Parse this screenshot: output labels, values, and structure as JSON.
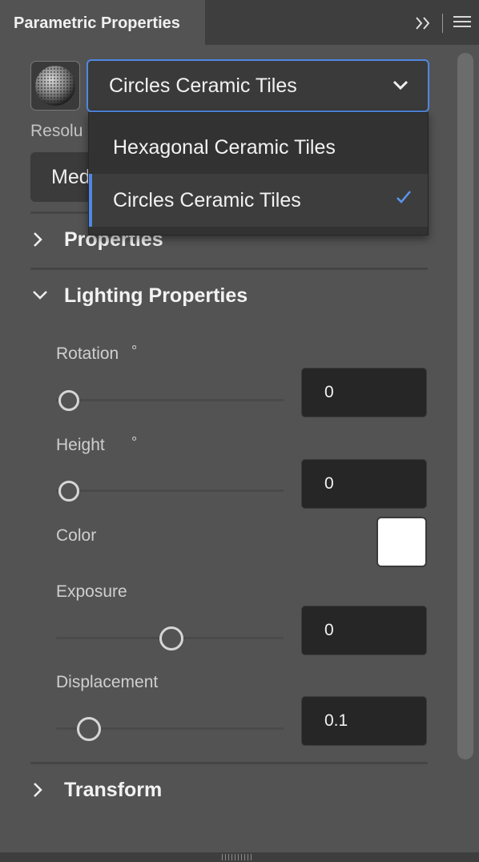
{
  "panel": {
    "title": "Parametric Properties"
  },
  "material": {
    "selected": "Circles Ceramic Tiles",
    "options": [
      "Hexagonal Ceramic Tiles",
      "Circles Ceramic Tiles"
    ]
  },
  "resolution": {
    "label": "Resolu",
    "value": "Med"
  },
  "sections": {
    "properties": "Properties",
    "lighting": "Lighting Properties",
    "transform": "Transform"
  },
  "lighting": {
    "rotation": {
      "label": "Rotation",
      "unit": "°",
      "value": "0",
      "slider_fraction": 0.0
    },
    "height": {
      "label": "Height",
      "unit": "°",
      "value": "0",
      "slider_fraction": 0.0
    },
    "color": {
      "label": "Color",
      "value": "#ffffff"
    },
    "exposure": {
      "label": "Exposure",
      "value": "0",
      "slider_fraction": 0.5
    },
    "displacement": {
      "label": "Displacement",
      "value": "0.1",
      "slider_fraction": 0.1
    }
  },
  "colors": {
    "accent": "#4f88e3",
    "panel": "#535353",
    "field": "#262626"
  },
  "icons": [
    "collapse-panel-icon",
    "panel-menu-icon",
    "chevron-down-icon",
    "chevron-right-icon",
    "checkmark-icon"
  ]
}
